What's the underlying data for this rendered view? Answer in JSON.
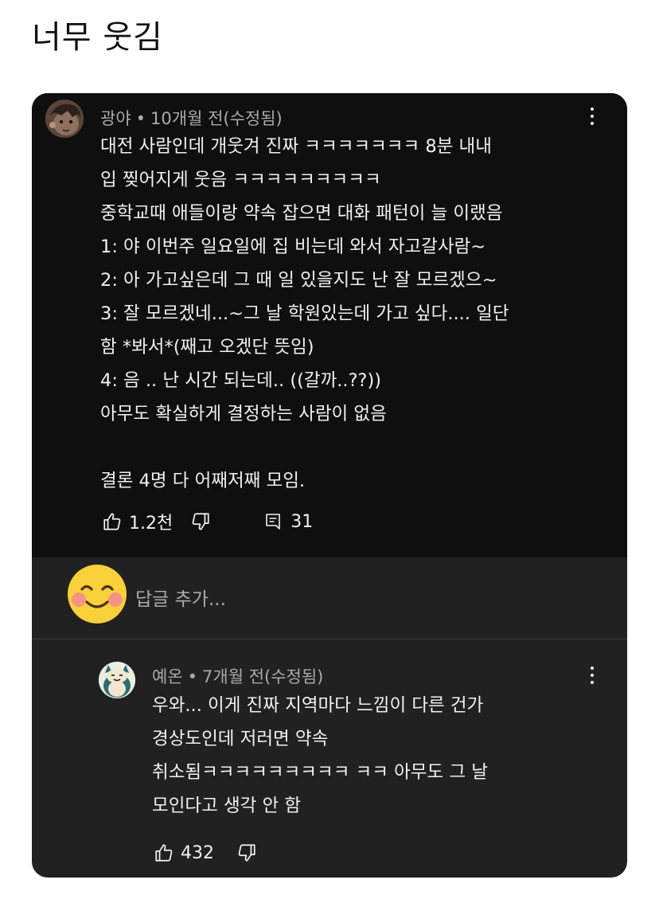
{
  "post": {
    "title": "너무 웃김"
  },
  "comment": {
    "author": "광야",
    "separator": "•",
    "time": "10개월 전(수정됨)",
    "lines": [
      "대전 사람인데 개웃겨 진짜 ㅋㅋㅋㅋㅋㅋㅋ 8분 내내",
      "입 찢어지게 웃음 ㅋㅋㅋㅋㅋㅋㅋㅋㅋ",
      "중학교때 애들이랑 약속 잡으면 대화 패턴이 늘 이랬음",
      "1: 야 이번주 일요일에 집 비는데 와서 자고갈사람~",
      "2: 아 가고싶은데 그 때 일 있을지도 난 잘 모르겠으~",
      "3: 잘 모르겠네...~그 날 학원있는데 가고 싶다.... 일단",
      "함 *봐서*(째고 오겠단 뜻임)",
      "4: 음 .. 난 시간 되는데.. ((갈까..??))",
      "아무도 확실하게 결정하는 사람이 없음",
      "",
      "결론 4명 다 어째저째 모임."
    ],
    "likes": "1.2천",
    "replies_count": "31",
    "icons": {
      "like": "thumbs-up-icon",
      "dislike": "thumbs-down-icon",
      "replies": "comment-icon",
      "more": "more-vert-icon"
    }
  },
  "reply_box": {
    "placeholder": "답글 추가..."
  },
  "reply": {
    "author": "예온",
    "separator": "•",
    "time": "7개월 전(수정됨)",
    "lines": [
      "우와... 이게 진짜 지역마다 느낌이 다른 건가",
      "경상도인데 저러면 약속",
      "취소됨ㅋㅋㅋㅋㅋㅋㅋㅋㅋ ㅋㅋ 아무도 그 날",
      "모인다고 생각 안 함"
    ],
    "likes": "432"
  },
  "colors": {
    "comment_bg": "#0f0f0f",
    "panel_bg": "#212121",
    "text_primary": "#f1f1f1",
    "text_secondary": "#aaaaaa"
  }
}
